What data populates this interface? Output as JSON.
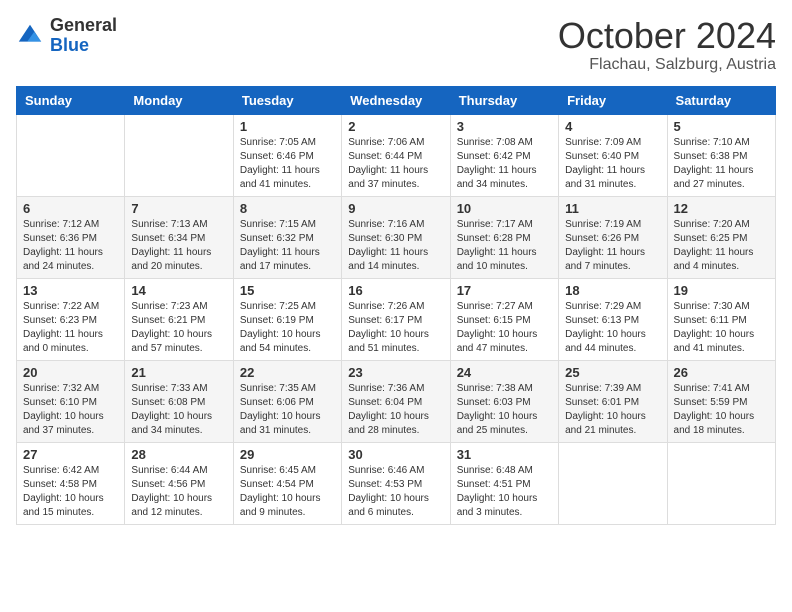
{
  "header": {
    "logo_general": "General",
    "logo_blue": "Blue",
    "month_title": "October 2024",
    "location": "Flachau, Salzburg, Austria"
  },
  "days_of_week": [
    "Sunday",
    "Monday",
    "Tuesday",
    "Wednesday",
    "Thursday",
    "Friday",
    "Saturday"
  ],
  "weeks": [
    [
      {
        "day": "",
        "content": ""
      },
      {
        "day": "",
        "content": ""
      },
      {
        "day": "1",
        "content": "Sunrise: 7:05 AM\nSunset: 6:46 PM\nDaylight: 11 hours and 41 minutes."
      },
      {
        "day": "2",
        "content": "Sunrise: 7:06 AM\nSunset: 6:44 PM\nDaylight: 11 hours and 37 minutes."
      },
      {
        "day": "3",
        "content": "Sunrise: 7:08 AM\nSunset: 6:42 PM\nDaylight: 11 hours and 34 minutes."
      },
      {
        "day": "4",
        "content": "Sunrise: 7:09 AM\nSunset: 6:40 PM\nDaylight: 11 hours and 31 minutes."
      },
      {
        "day": "5",
        "content": "Sunrise: 7:10 AM\nSunset: 6:38 PM\nDaylight: 11 hours and 27 minutes."
      }
    ],
    [
      {
        "day": "6",
        "content": "Sunrise: 7:12 AM\nSunset: 6:36 PM\nDaylight: 11 hours and 24 minutes."
      },
      {
        "day": "7",
        "content": "Sunrise: 7:13 AM\nSunset: 6:34 PM\nDaylight: 11 hours and 20 minutes."
      },
      {
        "day": "8",
        "content": "Sunrise: 7:15 AM\nSunset: 6:32 PM\nDaylight: 11 hours and 17 minutes."
      },
      {
        "day": "9",
        "content": "Sunrise: 7:16 AM\nSunset: 6:30 PM\nDaylight: 11 hours and 14 minutes."
      },
      {
        "day": "10",
        "content": "Sunrise: 7:17 AM\nSunset: 6:28 PM\nDaylight: 11 hours and 10 minutes."
      },
      {
        "day": "11",
        "content": "Sunrise: 7:19 AM\nSunset: 6:26 PM\nDaylight: 11 hours and 7 minutes."
      },
      {
        "day": "12",
        "content": "Sunrise: 7:20 AM\nSunset: 6:25 PM\nDaylight: 11 hours and 4 minutes."
      }
    ],
    [
      {
        "day": "13",
        "content": "Sunrise: 7:22 AM\nSunset: 6:23 PM\nDaylight: 11 hours and 0 minutes."
      },
      {
        "day": "14",
        "content": "Sunrise: 7:23 AM\nSunset: 6:21 PM\nDaylight: 10 hours and 57 minutes."
      },
      {
        "day": "15",
        "content": "Sunrise: 7:25 AM\nSunset: 6:19 PM\nDaylight: 10 hours and 54 minutes."
      },
      {
        "day": "16",
        "content": "Sunrise: 7:26 AM\nSunset: 6:17 PM\nDaylight: 10 hours and 51 minutes."
      },
      {
        "day": "17",
        "content": "Sunrise: 7:27 AM\nSunset: 6:15 PM\nDaylight: 10 hours and 47 minutes."
      },
      {
        "day": "18",
        "content": "Sunrise: 7:29 AM\nSunset: 6:13 PM\nDaylight: 10 hours and 44 minutes."
      },
      {
        "day": "19",
        "content": "Sunrise: 7:30 AM\nSunset: 6:11 PM\nDaylight: 10 hours and 41 minutes."
      }
    ],
    [
      {
        "day": "20",
        "content": "Sunrise: 7:32 AM\nSunset: 6:10 PM\nDaylight: 10 hours and 37 minutes."
      },
      {
        "day": "21",
        "content": "Sunrise: 7:33 AM\nSunset: 6:08 PM\nDaylight: 10 hours and 34 minutes."
      },
      {
        "day": "22",
        "content": "Sunrise: 7:35 AM\nSunset: 6:06 PM\nDaylight: 10 hours and 31 minutes."
      },
      {
        "day": "23",
        "content": "Sunrise: 7:36 AM\nSunset: 6:04 PM\nDaylight: 10 hours and 28 minutes."
      },
      {
        "day": "24",
        "content": "Sunrise: 7:38 AM\nSunset: 6:03 PM\nDaylight: 10 hours and 25 minutes."
      },
      {
        "day": "25",
        "content": "Sunrise: 7:39 AM\nSunset: 6:01 PM\nDaylight: 10 hours and 21 minutes."
      },
      {
        "day": "26",
        "content": "Sunrise: 7:41 AM\nSunset: 5:59 PM\nDaylight: 10 hours and 18 minutes."
      }
    ],
    [
      {
        "day": "27",
        "content": "Sunrise: 6:42 AM\nSunset: 4:58 PM\nDaylight: 10 hours and 15 minutes."
      },
      {
        "day": "28",
        "content": "Sunrise: 6:44 AM\nSunset: 4:56 PM\nDaylight: 10 hours and 12 minutes."
      },
      {
        "day": "29",
        "content": "Sunrise: 6:45 AM\nSunset: 4:54 PM\nDaylight: 10 hours and 9 minutes."
      },
      {
        "day": "30",
        "content": "Sunrise: 6:46 AM\nSunset: 4:53 PM\nDaylight: 10 hours and 6 minutes."
      },
      {
        "day": "31",
        "content": "Sunrise: 6:48 AM\nSunset: 4:51 PM\nDaylight: 10 hours and 3 minutes."
      },
      {
        "day": "",
        "content": ""
      },
      {
        "day": "",
        "content": ""
      }
    ]
  ]
}
